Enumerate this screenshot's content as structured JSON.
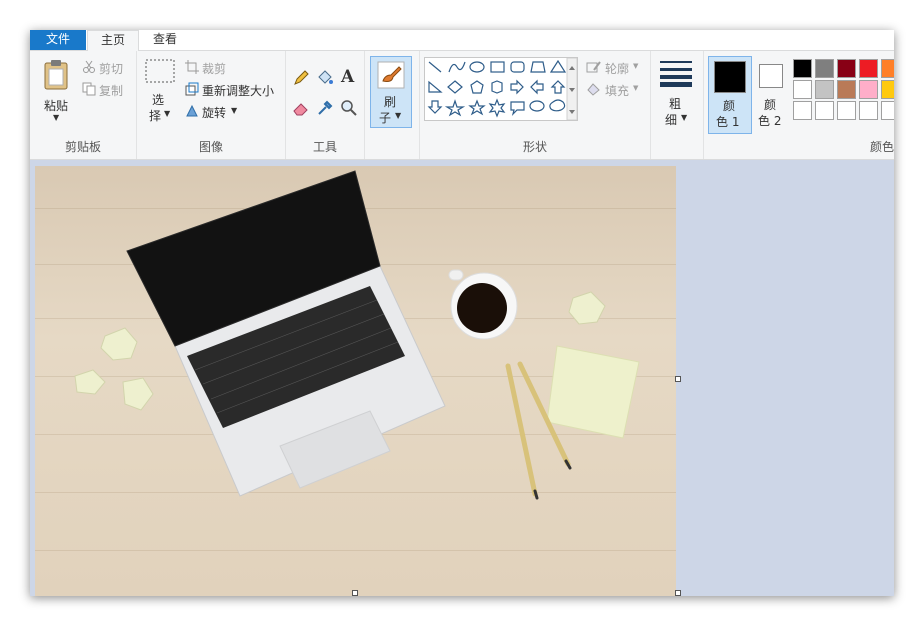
{
  "tabs": {
    "file": "文件",
    "home": "主页",
    "view": "查看"
  },
  "clipboard": {
    "paste": "粘贴",
    "cut": "剪切",
    "copy": "复制",
    "group": "剪贴板"
  },
  "image": {
    "select": "选",
    "select2": "择",
    "crop": "裁剪",
    "resize": "重新调整大小",
    "rotate": "旋转",
    "group": "图像"
  },
  "tools": {
    "group": "工具",
    "text_glyph": "A"
  },
  "brush": {
    "label1": "刷",
    "label2": "子"
  },
  "shapes": {
    "outline": "轮廓",
    "fill": "填充",
    "group": "形状"
  },
  "size": {
    "label1": "粗",
    "label2": "细"
  },
  "color1": {
    "label1": "颜",
    "label2": "色 1",
    "value": "#000000"
  },
  "color2": {
    "label1": "颜",
    "label2": "色 2",
    "value": "#ffffff"
  },
  "colors": {
    "group": "颜色",
    "row1": [
      "#000000",
      "#7f7f7f",
      "#880015",
      "#ed1c24",
      "#ff7f27"
    ],
    "row2": [
      "#ffffff",
      "#c3c3c3",
      "#b97a57",
      "#ffaec9",
      "#ffc90e"
    ],
    "row3": [
      "#ffffff",
      "#ffffff",
      "#ffffff",
      "#ffffff",
      "#ffffff"
    ]
  }
}
